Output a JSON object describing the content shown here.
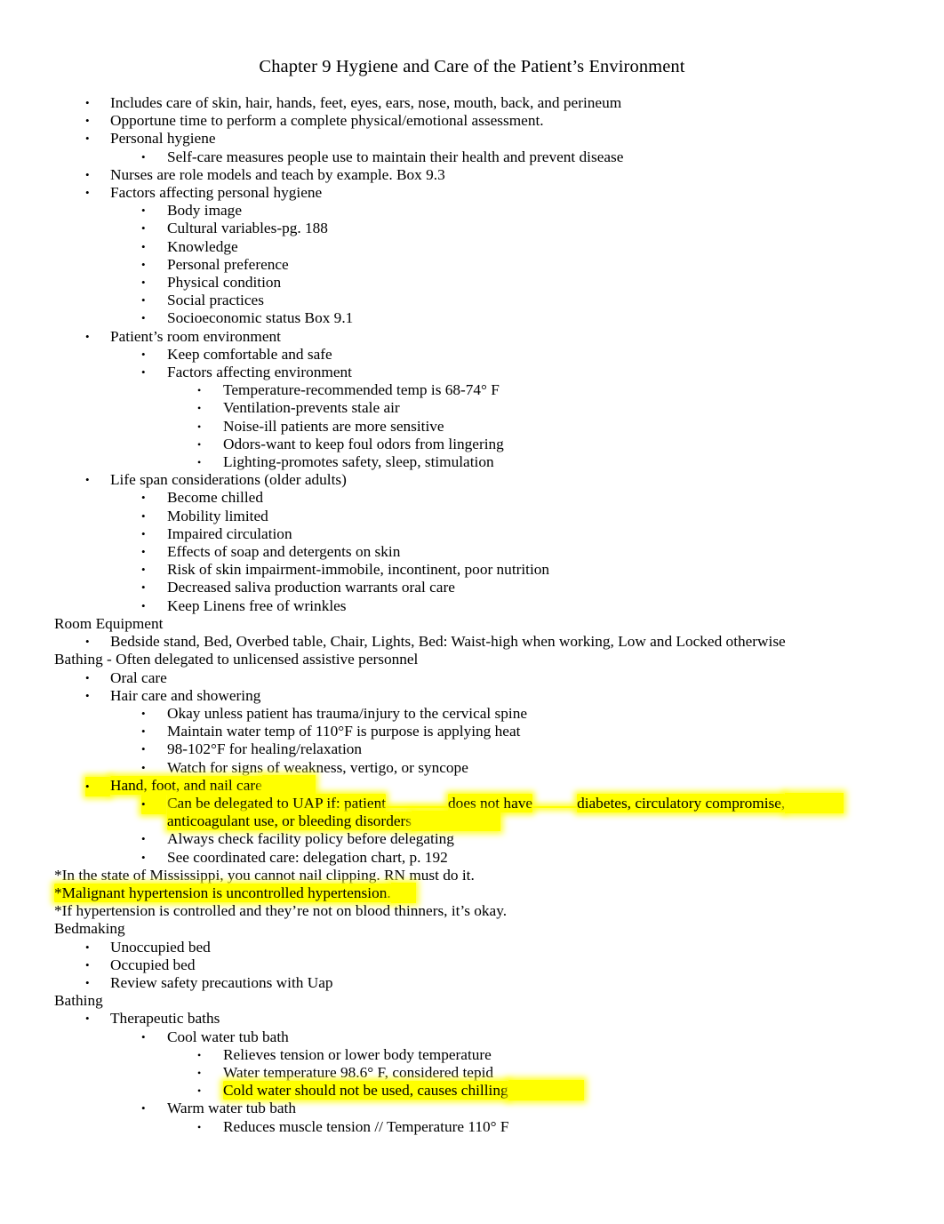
{
  "document": {
    "title": "Chapter 9 Hygiene and Care of the Patient’s Environment",
    "highlight_color": "#ffff00",
    "bullet_glyph": "•"
  },
  "lines": {
    "l1": "Includes care of skin, hair, hands, feet, eyes, ears, nose, mouth, back, and perineum",
    "l2": "Opportune time to perform a complete physical/emotional assessment.",
    "l3": "Personal hygiene",
    "l4": "Self-care measures people use to maintain their health and prevent disease",
    "l5": "Nurses are role models and teach by example. Box 9.3",
    "l6": "Factors affecting personal hygiene",
    "l7": "Body image",
    "l8": "Cultural variables-pg. 188",
    "l9": "Knowledge",
    "l10": "Personal preference",
    "l11": "Physical condition",
    "l12": "Social practices",
    "l13": "Socioeconomic status Box 9.1",
    "l14": "Patient’s room environment",
    "l15": "Keep comfortable and safe",
    "l16": "Factors affecting environment",
    "l17": "Temperature-recommended temp is 68-74° F",
    "l18": "Ventilation-prevents stale air",
    "l19": "Noise-ill patients are more sensitive",
    "l20": "Odors-want to keep foul odors from lingering",
    "l21": "Lighting-promotes safety, sleep, stimulation",
    "l22": "Life span considerations (older adults)",
    "l23": "Become chilled",
    "l24": "Mobility limited",
    "l25": "Impaired circulation",
    "l26": "Effects of soap and detergents on skin",
    "l27": "Risk of skin impairment-immobile, incontinent, poor nutrition",
    "l28": "Decreased saliva production warrants oral care",
    "l29": "Keep Linens free of wrinkles",
    "l30": "Room Equipment",
    "l31": "Bedside stand, Bed, Overbed table, Chair, Lights, Bed: Waist-high when working, Low and Locked otherwise",
    "l32": "Bathing - Often delegated to unlicensed assistive personnel",
    "l33": "Oral care",
    "l34": "Hair care and showering",
    "l35": "Okay unless patient has trauma/injury to the cervical spine",
    "l36": "Maintain water temp of 110°F is purpose is applying heat",
    "l37": "98-102°F for healing/relaxation",
    "l38": "Watch for signs of weakness, vertigo, or syncope",
    "l39": "Hand, foot, and nail care",
    "l40a": "Can be delegated to UAP if: patient",
    "l40b": "does not have",
    "l40c": "diabetes, circulatory compromise,",
    "l40d": "anticoagulant use, or bleeding disorders",
    "l41": "Always check facility policy before delegating",
    "l42": "See coordinated care: delegation chart, p. 192",
    "l43": "*In the state of Mississippi, you cannot nail clipping. RN must do it.",
    "l44": "*Malignant hypertension is uncontrolled hypertension.",
    "l45": "*If hypertension is controlled and they’re not on blood thinners, it’s okay.",
    "l46": "Bedmaking",
    "l47": "Unoccupied bed",
    "l48": "Occupied bed",
    "l49": "Review safety precautions with Uap",
    "l50": "Bathing",
    "l51": "Therapeutic baths",
    "l52": "Cool water tub bath",
    "l53": "Relieves tension or lower body temperature",
    "l54": "Water temperature 98.6° F, considered tepid",
    "l55": "Cold water should not be used, causes chilling",
    "l56": "Warm water tub bath",
    "l57": "Reduces muscle tension // Temperature 110° F"
  }
}
